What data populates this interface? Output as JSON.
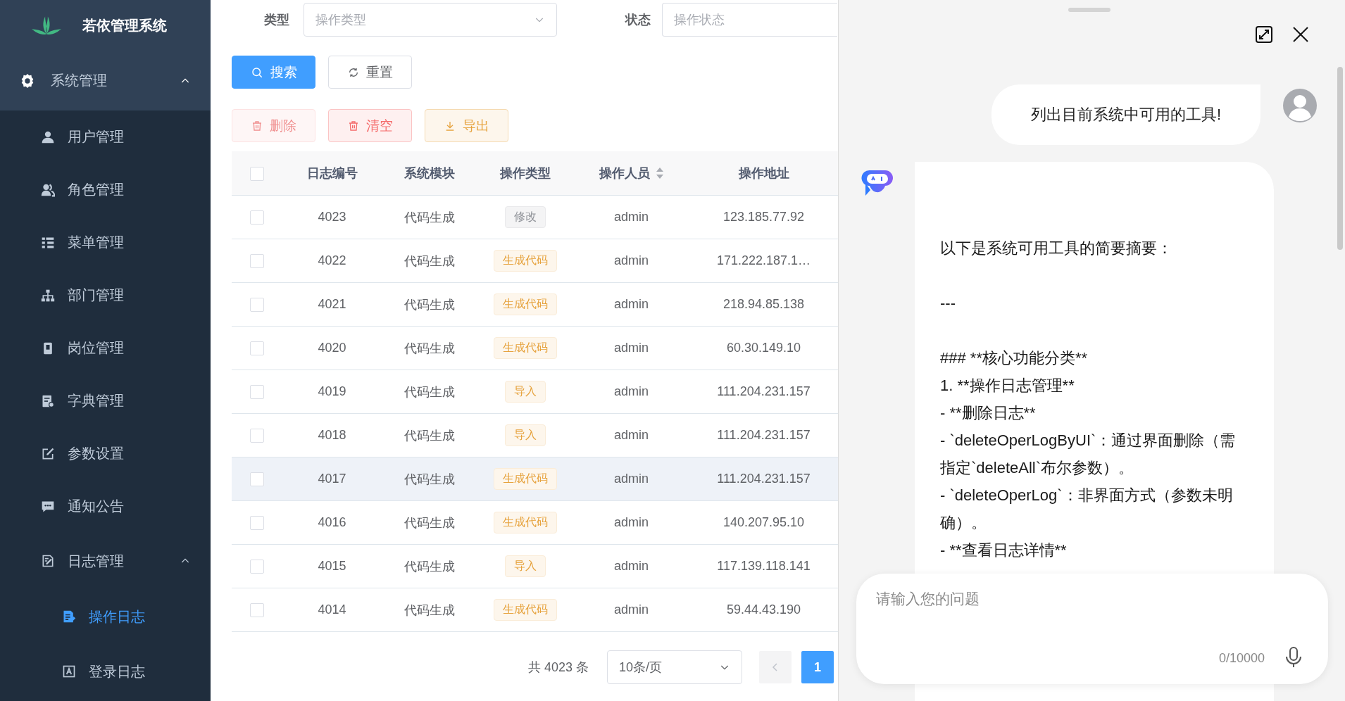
{
  "sidebar": {
    "logo_title": "若依管理系统",
    "menu": [
      {
        "label": "系统管理",
        "expanded": true,
        "children": [
          {
            "label": "用户管理",
            "selected": false
          },
          {
            "label": "角色管理",
            "selected": false
          },
          {
            "label": "菜单管理",
            "selected": false
          },
          {
            "label": "部门管理",
            "selected": false
          },
          {
            "label": "岗位管理",
            "selected": false
          },
          {
            "label": "字典管理",
            "selected": false
          },
          {
            "label": "参数设置",
            "selected": false
          },
          {
            "label": "通知公告",
            "selected": false
          },
          {
            "label": "日志管理",
            "expanded": true,
            "children": [
              {
                "label": "操作日志",
                "selected": true
              },
              {
                "label": "登录日志",
                "selected": false
              }
            ]
          }
        ]
      }
    ]
  },
  "filters": [
    {
      "label": "类型",
      "placeholder": "操作类型"
    },
    {
      "label": "状态",
      "placeholder": "操作状态"
    }
  ],
  "search_buttons": [
    {
      "label": "搜索",
      "kind": "primary",
      "disabled": false
    },
    {
      "label": "重置",
      "kind": "default",
      "disabled": false
    }
  ],
  "action_buttons": [
    {
      "label": "删除",
      "kind": "danger",
      "disabled": true
    },
    {
      "label": "清空",
      "kind": "danger",
      "disabled": false
    },
    {
      "label": "导出",
      "kind": "warning",
      "disabled": false
    }
  ],
  "table": {
    "header_checked": false,
    "columns": [
      {
        "label": "日志编号",
        "sortable": false
      },
      {
        "label": "系统模块",
        "sortable": false
      },
      {
        "label": "操作类型",
        "sortable": false
      },
      {
        "label": "操作人员",
        "sortable": true
      },
      {
        "label": "操作地址",
        "sortable": false
      }
    ],
    "rows": [
      {
        "checked": false,
        "hovered": false,
        "id": "4023",
        "module": "代码生成",
        "type": {
          "label": "修改",
          "kind": "info"
        },
        "operator": "admin",
        "address": "123.185.77.92"
      },
      {
        "checked": false,
        "hovered": false,
        "id": "4022",
        "module": "代码生成",
        "type": {
          "label": "生成代码",
          "kind": "warning"
        },
        "operator": "admin",
        "address": "171.222.187.1…"
      },
      {
        "checked": false,
        "hovered": false,
        "id": "4021",
        "module": "代码生成",
        "type": {
          "label": "生成代码",
          "kind": "warning"
        },
        "operator": "admin",
        "address": "218.94.85.138"
      },
      {
        "checked": false,
        "hovered": false,
        "id": "4020",
        "module": "代码生成",
        "type": {
          "label": "生成代码",
          "kind": "warning"
        },
        "operator": "admin",
        "address": "60.30.149.10"
      },
      {
        "checked": false,
        "hovered": false,
        "id": "4019",
        "module": "代码生成",
        "type": {
          "label": "导入",
          "kind": "warning"
        },
        "operator": "admin",
        "address": "111.204.231.157"
      },
      {
        "checked": false,
        "hovered": false,
        "id": "4018",
        "module": "代码生成",
        "type": {
          "label": "导入",
          "kind": "warning"
        },
        "operator": "admin",
        "address": "111.204.231.157"
      },
      {
        "checked": false,
        "hovered": true,
        "id": "4017",
        "module": "代码生成",
        "type": {
          "label": "生成代码",
          "kind": "warning"
        },
        "operator": "admin",
        "address": "111.204.231.157"
      },
      {
        "checked": false,
        "hovered": false,
        "id": "4016",
        "module": "代码生成",
        "type": {
          "label": "生成代码",
          "kind": "warning"
        },
        "operator": "admin",
        "address": "140.207.95.10"
      },
      {
        "checked": false,
        "hovered": false,
        "id": "4015",
        "module": "代码生成",
        "type": {
          "label": "导入",
          "kind": "warning"
        },
        "operator": "admin",
        "address": "117.139.118.141"
      },
      {
        "checked": false,
        "hovered": false,
        "id": "4014",
        "module": "代码生成",
        "type": {
          "label": "生成代码",
          "kind": "warning"
        },
        "operator": "admin",
        "address": "59.44.43.190"
      }
    ]
  },
  "pagination": {
    "total": "共 4023 条",
    "page_size": "10条/页",
    "prev_disabled": true,
    "pages": [
      {
        "label": "1",
        "selected": true
      }
    ]
  },
  "chat": {
    "messages": [
      {
        "kind": "user",
        "text": "列出目前系统中可用的工具!"
      },
      {
        "kind": "assistant",
        "lines": [
          {
            "kind": "para",
            "text": "以下是系统可用工具的简要摘要："
          },
          {
            "kind": "para",
            "text": "---"
          },
          {
            "kind": "line",
            "text": "### **核心功能分类**"
          },
          {
            "kind": "line",
            "text": "1. **操作日志管理**"
          },
          {
            "kind": "line",
            "text": "- **删除日志**"
          },
          {
            "kind": "line",
            "text": "- `deleteOperLogByUI`：通过界面删除（需指定`deleteAll`布尔参数）。"
          },
          {
            "kind": "line",
            "text": "- `deleteOperLog`：非界面方式（参数未明确）。"
          },
          {
            "kind": "line",
            "text": "- **查看日志详情**"
          }
        ]
      }
    ],
    "input": {
      "placeholder": "请输入您的问题",
      "counter": "0/10000"
    }
  }
}
